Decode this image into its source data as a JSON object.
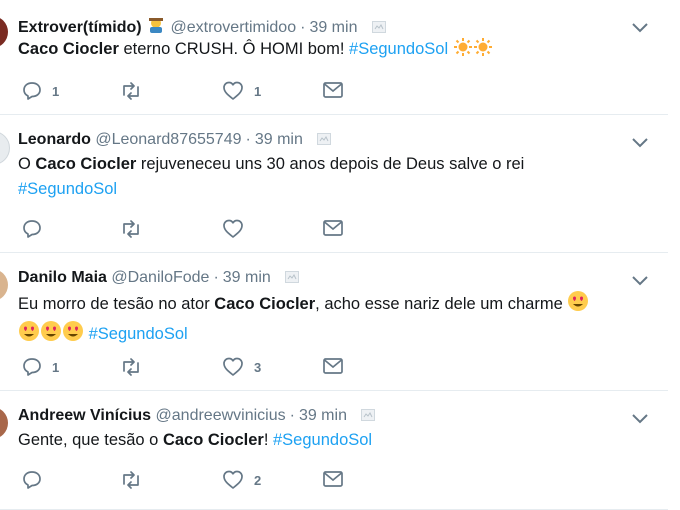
{
  "tweets": [
    {
      "name": "Extrover(tímido)",
      "handle": "@extrovertimidoo",
      "time": "39 min",
      "text": [
        {
          "b": "Caco Ciocler"
        },
        {
          "t": " eterno CRUSH. Ô HOMI bom! "
        },
        {
          "tag": "#SegundoSol"
        }
      ],
      "emoji_after": [
        "sun",
        "sun"
      ],
      "replies": "1",
      "retweets": "",
      "likes": "1"
    },
    {
      "name": "Leonardo",
      "handle": "@Leonard87655749",
      "time": "39 min",
      "text": [
        {
          "t": "O "
        },
        {
          "b": "Caco Ciocler"
        },
        {
          "t": " rejuveneceu uns 30 anos  depois  de Deus salve o rei"
        }
      ],
      "line2": "#SegundoSol",
      "replies": "",
      "retweets": "",
      "likes": ""
    },
    {
      "name": "Danilo Maia",
      "handle": "@DaniloFode",
      "time": "39 min",
      "text": [
        {
          "t": "Eu morro de tesão no ator "
        },
        {
          "b": "Caco Ciocler"
        },
        {
          "t": ", acho esse nariz dele um charme "
        }
      ],
      "line2": "#SegundoSol",
      "replies": "1",
      "retweets": "",
      "likes": "3"
    },
    {
      "name": "Andreew Vinícius",
      "handle": "@andreewvinicius",
      "time": "39 min",
      "text": [
        {
          "t": "Gente, que tesão o "
        },
        {
          "b": "Caco Ciocler"
        },
        {
          "t": "! "
        },
        {
          "tag": "#SegundoSol"
        }
      ],
      "replies": "",
      "retweets": "",
      "likes": "2"
    }
  ],
  "icons": {
    "reply": "reply-icon",
    "retweet": "retweet-icon",
    "like": "heart-icon",
    "dm": "envelope-icon",
    "menu": "chevron-down-icon"
  },
  "colors": {
    "hashtag": "#1da1f2",
    "muted": "#657786",
    "border": "#e6ecf0"
  }
}
